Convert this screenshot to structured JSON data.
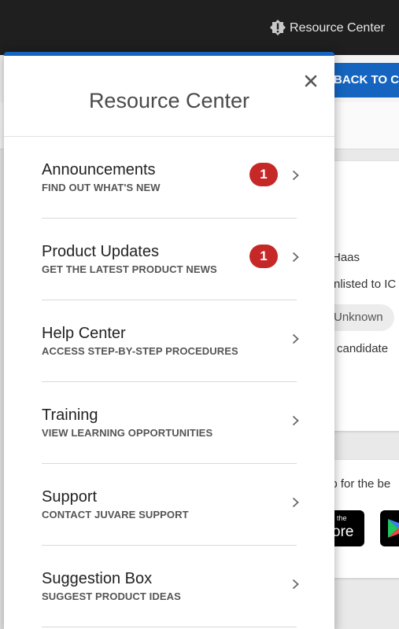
{
  "top_bar": {
    "resource_center_label": "Resource Center"
  },
  "background": {
    "back_button_label": "BACK TO CI",
    "card": {
      "name_fragment": "Haas",
      "status_fragment": "nlisted to IC",
      "chip_label": "Unknown",
      "candidate_fragment": "candidate"
    },
    "app_card": {
      "text_fragment": "op for the be",
      "app_store_small": "the",
      "app_store_big": "ore"
    }
  },
  "panel": {
    "title": "Resource Center",
    "items": [
      {
        "title": "Announcements",
        "subtitle": "FIND OUT WHAT'S NEW",
        "badge": "1"
      },
      {
        "title": "Product Updates",
        "subtitle": "GET THE LATEST PRODUCT NEWS",
        "badge": "1"
      },
      {
        "title": "Help Center",
        "subtitle": "ACCESS STEP-BY-STEP PROCEDURES"
      },
      {
        "title": "Training",
        "subtitle": "VIEW LEARNING OPPORTUNITIES"
      },
      {
        "title": "Support",
        "subtitle": "CONTACT JUVARE SUPPORT"
      },
      {
        "title": "Suggestion Box",
        "subtitle": "SUGGEST PRODUCT IDEAS"
      }
    ]
  },
  "icons": {
    "resource_center": "alert-badge-icon",
    "close": "close-icon",
    "chevron": "chevron-right-icon",
    "play_store": "play-store-icon"
  },
  "colors": {
    "accent": "#1565c0",
    "badge": "#c62828",
    "top_bar": "#1f1f1f"
  }
}
